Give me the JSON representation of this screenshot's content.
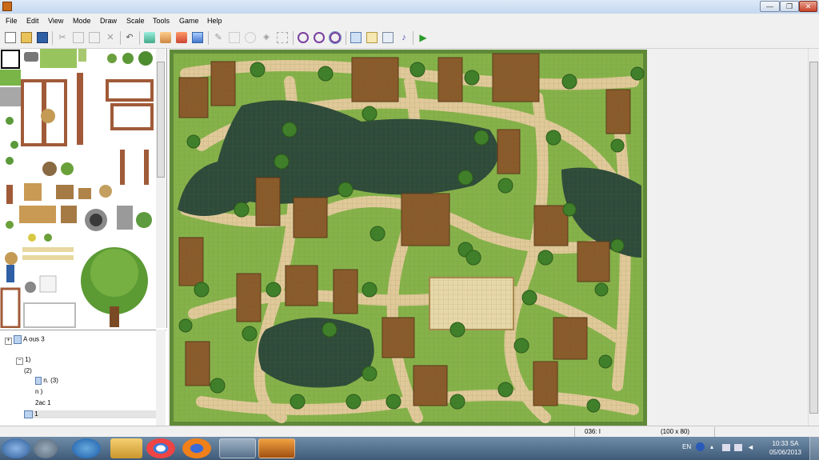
{
  "window": {
    "title": "",
    "controls": {
      "minimize": "—",
      "maximize": "❐",
      "close": "✕"
    }
  },
  "menu": [
    "File",
    "Edit",
    "View",
    "Mode",
    "Draw",
    "Scale",
    "Tools",
    "Game",
    "Help"
  ],
  "toolbar": {
    "icons": [
      "new-project-icon",
      "open-project-icon",
      "save-project-icon",
      "cut-icon",
      "copy-icon",
      "paste-icon",
      "delete-icon",
      "undo-icon",
      "layer-1-icon",
      "layer-2-icon",
      "layer-3-icon",
      "event-layer-icon",
      "pencil-icon",
      "rectangle-icon",
      "ellipse-icon",
      "flood-fill-icon",
      "select-icon",
      "zoom-1-icon",
      "zoom-2-icon",
      "zoom-4-icon",
      "database-icon",
      "material-base-icon",
      "script-editor-icon",
      "sound-test-icon",
      "playtest-icon"
    ]
  },
  "tree": {
    "rows": [
      {
        "text": "A    ous 3",
        "indent": 0
      },
      {
        "text": "",
        "indent": 1
      },
      {
        "text": "                1)",
        "indent": 1
      },
      {
        "text": "                     (2)",
        "indent": 2
      },
      {
        "text": "              n.  (3)",
        "indent": 2
      },
      {
        "text": "                n   )",
        "indent": 2
      },
      {
        "text": "            2ac  1",
        "indent": 2
      },
      {
        "text": "              1",
        "indent": 2
      }
    ]
  },
  "status": {
    "map_id": "036: I",
    "map_size": "(100 x 80)"
  },
  "taskbar": {
    "apps": [
      "windows-start-icon",
      "media-icon",
      "ie-icon",
      "explorer-icon",
      "chrome-icon",
      "firefox-icon",
      "media-player-icon",
      "rpgmaker-icon"
    ],
    "tray": {
      "language": "EN",
      "time": "10:33 SA",
      "date": "05/06/2013"
    }
  }
}
